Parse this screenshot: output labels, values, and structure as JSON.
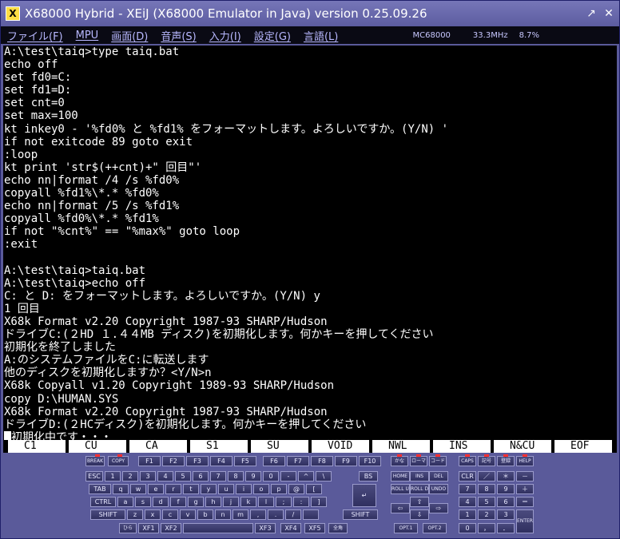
{
  "window": {
    "title": "X68000 Hybrid - XEiJ (X68000 Emulator in Java) version 0.25.09.26",
    "app_icon": "X",
    "minimize_icon": "↗",
    "close_icon": "✕"
  },
  "menubar": {
    "items": [
      "ファイル(F)",
      "MPU",
      "画面(D)",
      "音声(S)",
      "入力(I)",
      "設定(G)",
      "言語(L)"
    ],
    "cpu": "MC68000",
    "clock": "33.3MHz",
    "load": "8.7%"
  },
  "terminal": {
    "lines": [
      "A:\\test\\taiq>type taiq.bat",
      "echo off",
      "set fd0=C:",
      "set fd1=D:",
      "set cnt=0",
      "set max=100",
      "kt inkey0 - '%fd0% と %fd1% をフォーマットします。よろしいですか。(Y/N) '",
      "if not exitcode 89 goto exit",
      ":loop",
      "kt print 'str$(++cnt)+\" 回目\"'",
      "echo nn|format /4 /s %fd0%",
      "copyall %fd1%\\*.* %fd0%",
      "echo nn|format /5 /s %fd1%",
      "copyall %fd0%\\*.* %fd1%",
      "if not \"%cnt%\" == \"%max%\" goto loop",
      ":exit",
      "",
      "A:\\test\\taiq>taiq.bat",
      "A:\\test\\taiq>echo off",
      "C: と D: をフォーマットします。よろしいですか。(Y/N) y",
      "1 回目",
      "X68k Format v2.20 Copyright 1987-93 SHARP/Hudson",
      "ドライブC:(２HD １.４４MB ディスク)を初期化します。何かキーを押してください",
      "初期化を終了しました",
      "A:のシステムファイルをC:に転送します",
      "他のディスクを初期化しますか？<Y/N>n",
      "X68k Copyall v1.20 Copyright 1989-93 SHARP/Hudson",
      "copy D:\\HUMAN.SYS",
      "X68k Format v2.20 Copyright 1987-93 SHARP/Hudson",
      "ドライブD:(２HCディスク)を初期化します。何かキーを押してください",
      "初期化中です・・・"
    ]
  },
  "function_keys": [
    "C1",
    "CU",
    "CA",
    "S1",
    "SU",
    "VOID",
    "NWL",
    "INS",
    "N&CU",
    "EOF"
  ],
  "keyboard": {
    "row0_left": [
      "BREAK",
      "COPY"
    ],
    "row0_fkeys": [
      "F1",
      "F2",
      "F3",
      "F4",
      "F5",
      "F6",
      "F7",
      "F8",
      "F9",
      "F10"
    ],
    "row0_mode": [
      "かな",
      "ローマ",
      "コード"
    ],
    "row0_right": [
      "CAPS",
      "記号",
      "登録",
      "HELP"
    ],
    "row1": [
      "ESC",
      "1",
      "2",
      "3",
      "4",
      "5",
      "6",
      "7",
      "8",
      "9",
      "0",
      "-",
      "^",
      "\\",
      "BS"
    ],
    "row2": [
      "TAB",
      "q",
      "w",
      "e",
      "r",
      "t",
      "y",
      "u",
      "i",
      "o",
      "p",
      "@",
      "["
    ],
    "row3": [
      "CTRL",
      "a",
      "s",
      "d",
      "f",
      "g",
      "h",
      "j",
      "k",
      "l",
      ";",
      ":",
      "]"
    ],
    "row4": [
      "SHIFT",
      "z",
      "x",
      "c",
      "v",
      "b",
      "n",
      "m",
      ",",
      ".",
      "/",
      "",
      "SHIFT"
    ],
    "row5": [
      "ひら",
      "XF1",
      "XF2",
      "",
      "XF3",
      "XF4",
      "XF5",
      "全角"
    ],
    "return_key": "↵",
    "edit_keys": [
      "HOME",
      "INS",
      "DEL",
      "ROLL UP",
      "ROLL DOWN",
      "UNDO"
    ],
    "arrows": {
      "up": "⇧",
      "left": "⇦",
      "right": "⇨",
      "down": "⇩"
    },
    "opt_keys": [
      "OPT.1",
      "OPT.2"
    ],
    "numpad": [
      "CLR",
      "／",
      "＊",
      "－",
      "7",
      "8",
      "9",
      "＋",
      "4",
      "5",
      "6",
      "＝",
      "1",
      "2",
      "3",
      "0",
      "，",
      "．"
    ],
    "enter_key": "ENTER"
  }
}
